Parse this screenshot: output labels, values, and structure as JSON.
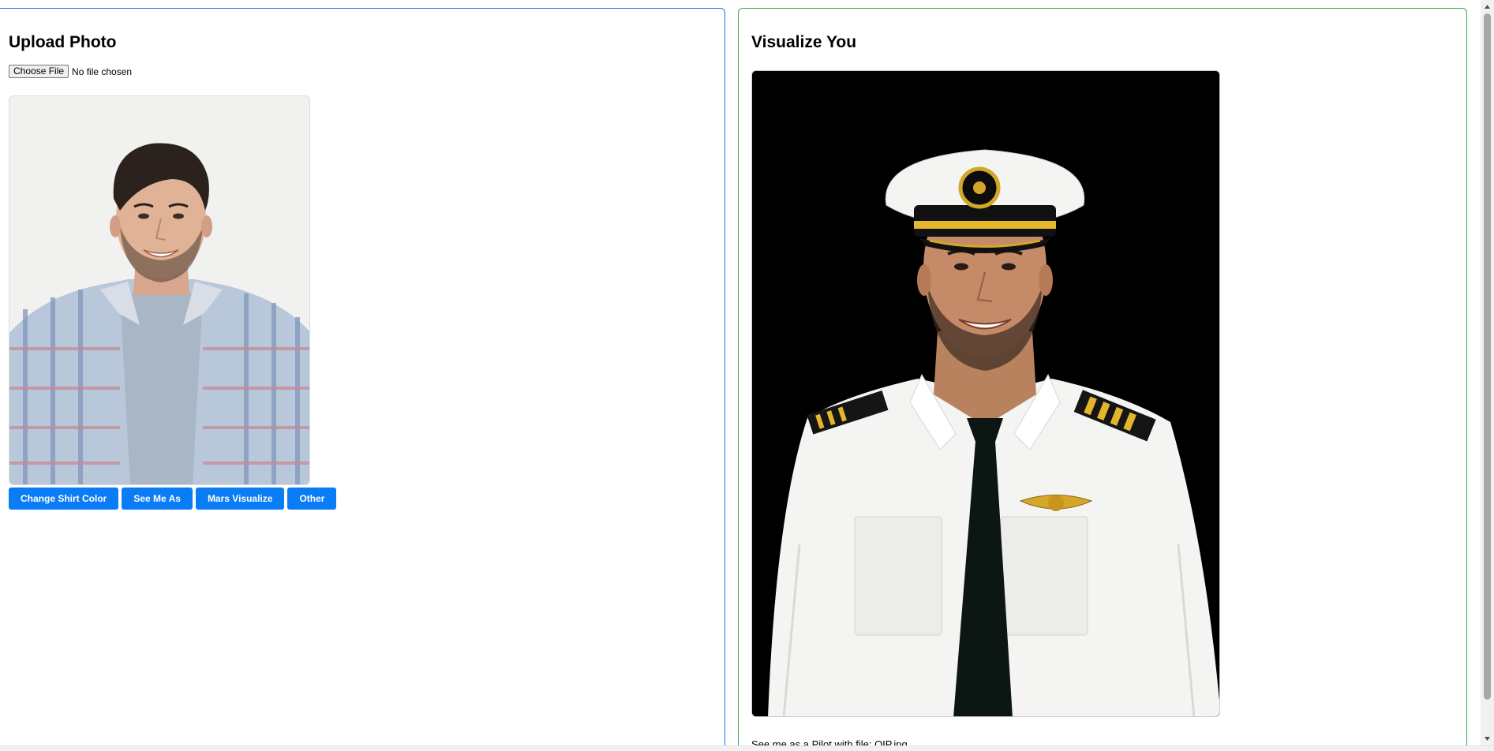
{
  "upload_panel": {
    "title": "Upload Photo",
    "file_input": {
      "button_label": "Choose File",
      "status": "No file chosen"
    },
    "actions": [
      "Change Shirt Color",
      "See Me As",
      "Mars Visualize",
      "Other"
    ]
  },
  "visualize_panel": {
    "title": "Visualize You",
    "caption": "See me as a Pilot with file: OIP.jpg"
  },
  "colors": {
    "accent_blue": "#0a7cf5",
    "left_border": "#1a73e8",
    "right_border": "#34a853"
  }
}
